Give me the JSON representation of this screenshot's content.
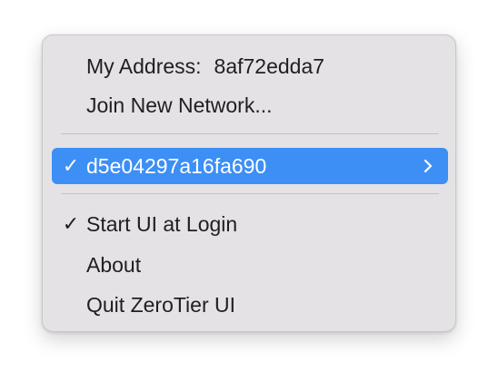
{
  "menu": {
    "address_label": "My Address:",
    "address_value": "8af72edda7",
    "join_label": "Join New Network...",
    "network": {
      "check": "✓",
      "id": "d5e04297a16fa690"
    },
    "start_at_login": {
      "check": "✓",
      "label": "Start UI at Login"
    },
    "about_label": "About",
    "quit_label": "Quit ZeroTier UI"
  },
  "colors": {
    "highlight": "#3d8ff5",
    "menu_bg": "#e4e2e4",
    "text": "#1f1f1f"
  },
  "icons": {
    "checkmark": "checkmark-icon",
    "submenu": "chevron-right-icon"
  }
}
